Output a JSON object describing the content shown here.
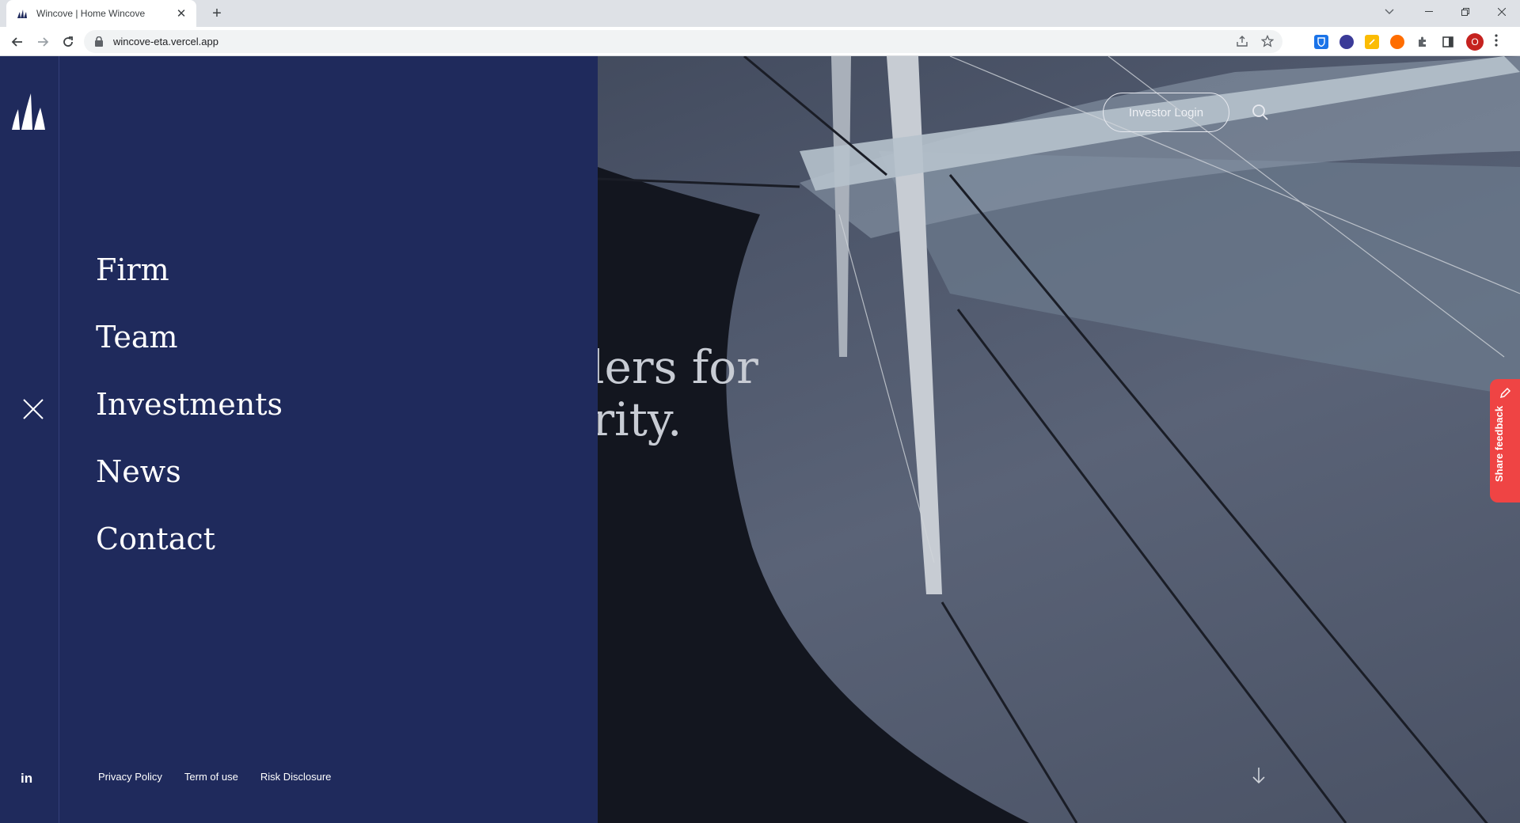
{
  "browser": {
    "tab_title": "Wincove | Home Wincove",
    "tab_close": "✕",
    "new_tab": "+",
    "url": "wincove-eta.vercel.app",
    "profile_initial": "O"
  },
  "rail": {
    "linkedin_label": "in"
  },
  "menu": {
    "items": [
      "Firm",
      "Team",
      "Investments",
      "News",
      "Contact"
    ],
    "footer_links": [
      "Privacy Policy",
      "Term of use",
      "Risk Disclosure"
    ]
  },
  "hero": {
    "headline_line1": "rket leaders for",
    "headline_line2": "ith integrity.",
    "investor_login": "Investor Login"
  },
  "feedback": {
    "label": "Share feedback",
    "color": "#ef4444"
  },
  "colors": {
    "menu_bg": "#1f2a5c",
    "accent_text": "#ffffff"
  }
}
